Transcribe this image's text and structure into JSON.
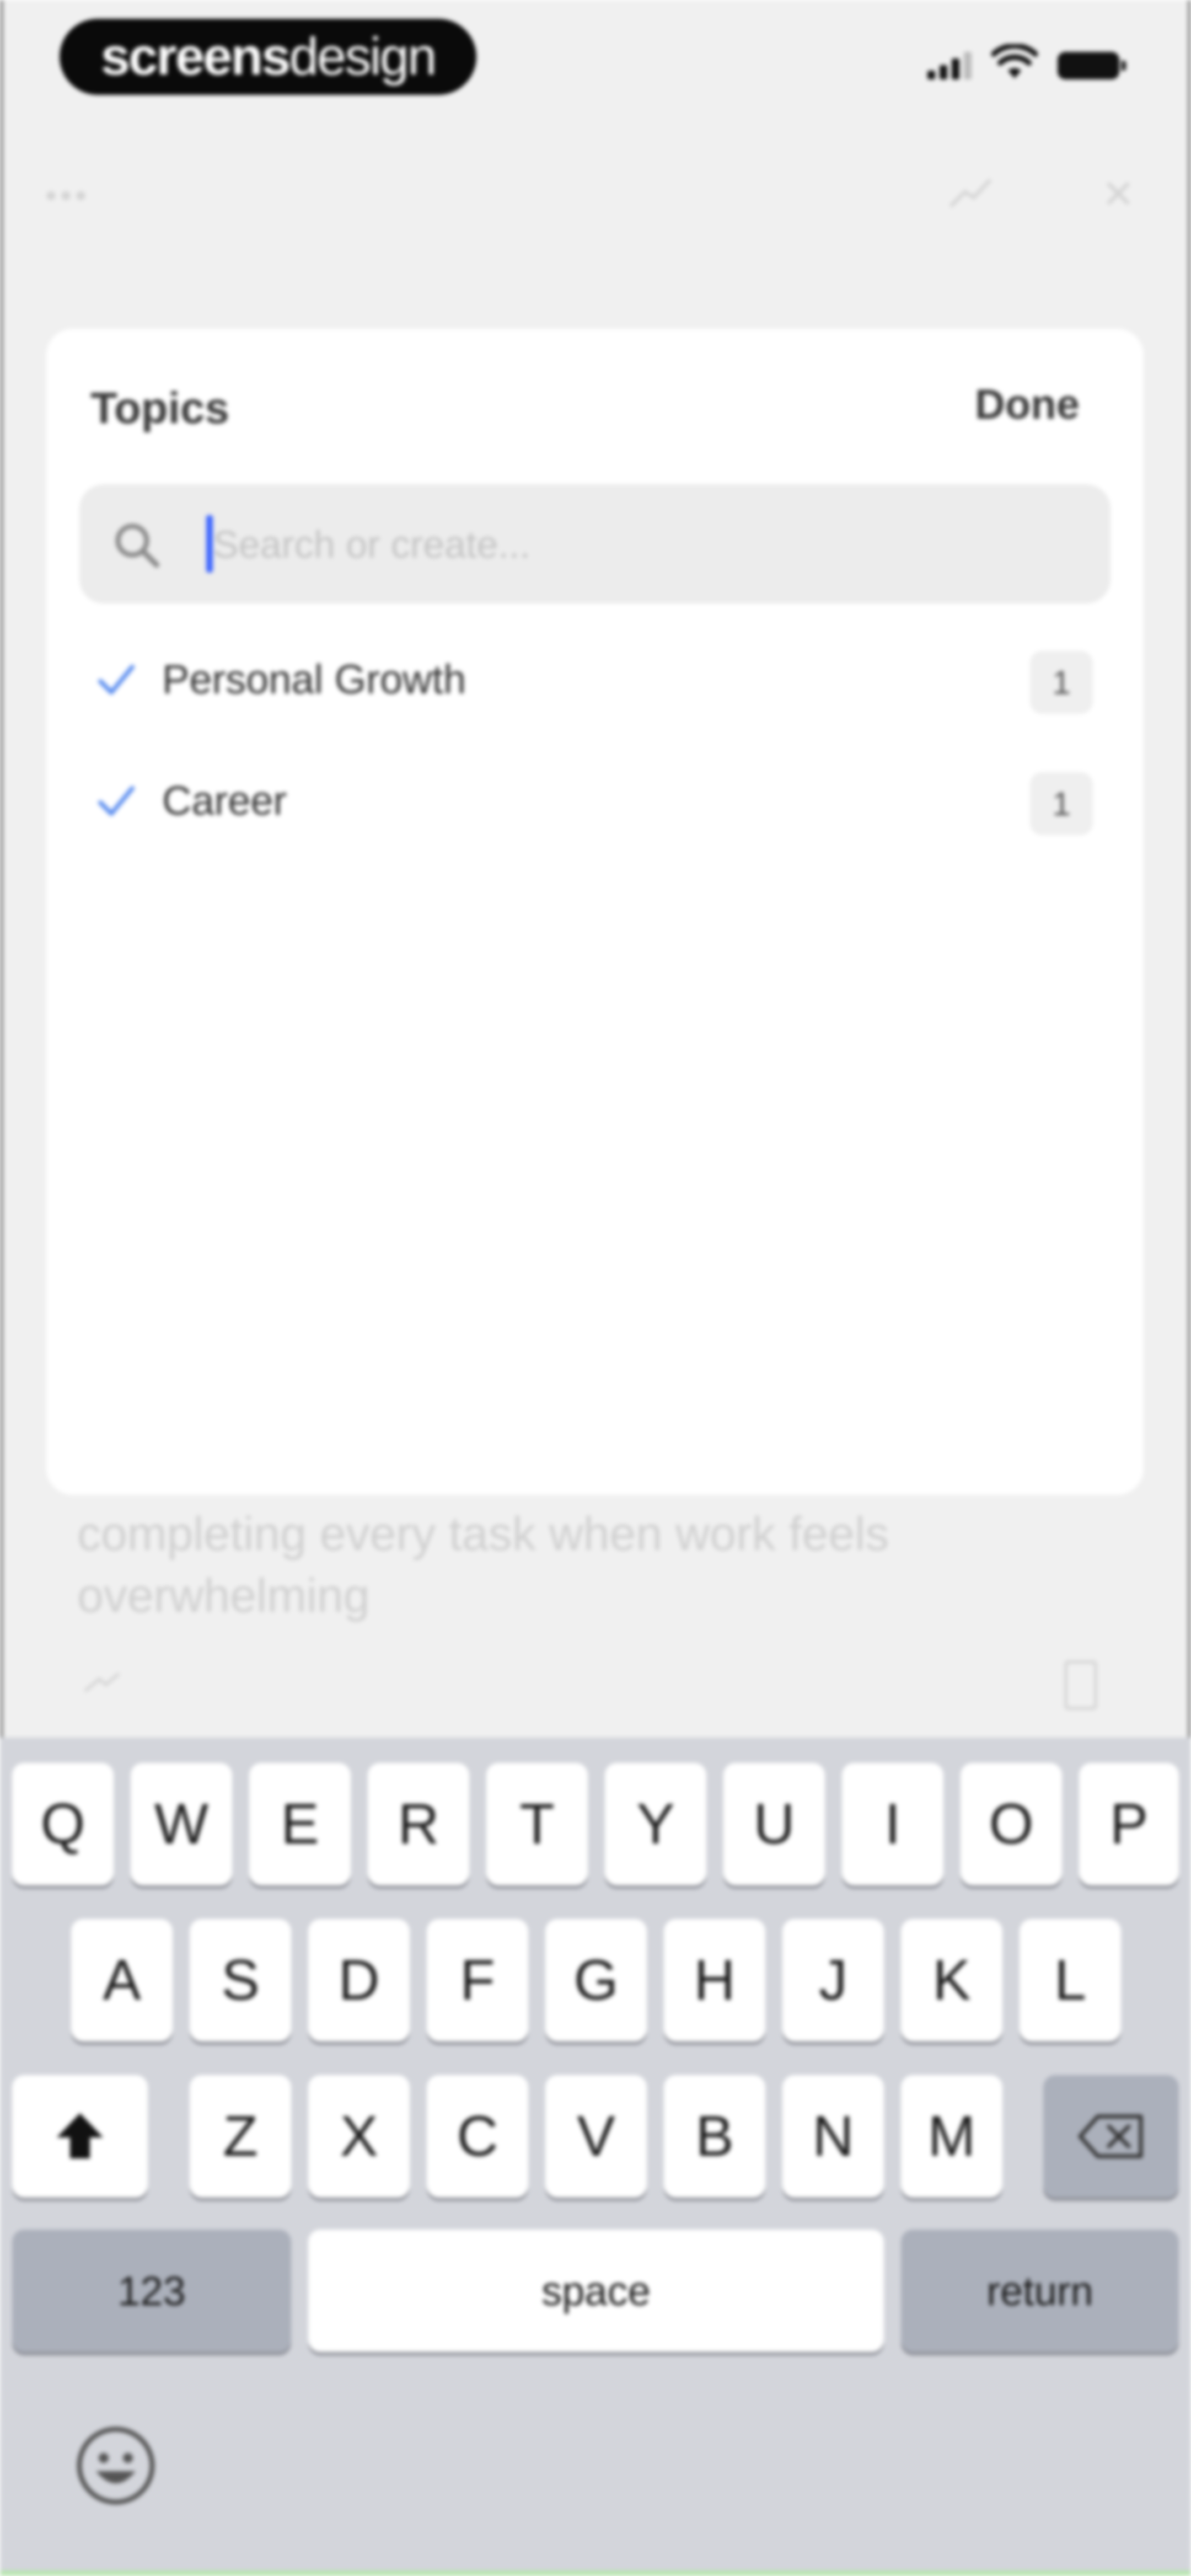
{
  "status_bar": {
    "watermark_bold": "screens",
    "watermark_light": "design"
  },
  "topics_sheet": {
    "title": "Topics",
    "done_label": "Done",
    "search": {
      "placeholder": "Search or create...",
      "value": ""
    },
    "items": [
      {
        "label": "Personal Growth",
        "count": "1",
        "checked": true
      },
      {
        "label": "Career",
        "count": "1",
        "checked": true
      }
    ]
  },
  "background": {
    "text": "completing every task when work feels overwhelming"
  },
  "keyboard": {
    "row1": [
      "Q",
      "W",
      "E",
      "R",
      "T",
      "Y",
      "U",
      "I",
      "O",
      "P"
    ],
    "row2": [
      "A",
      "S",
      "D",
      "F",
      "G",
      "H",
      "J",
      "K",
      "L"
    ],
    "row3": [
      "Z",
      "X",
      "C",
      "V",
      "B",
      "N",
      "M"
    ],
    "numbers_label": "123",
    "space_label": "space",
    "return_label": "return"
  },
  "colors": {
    "accent": "#3b64ff",
    "check": "#5b8def",
    "keyboard_bg": "#d3d5db"
  }
}
